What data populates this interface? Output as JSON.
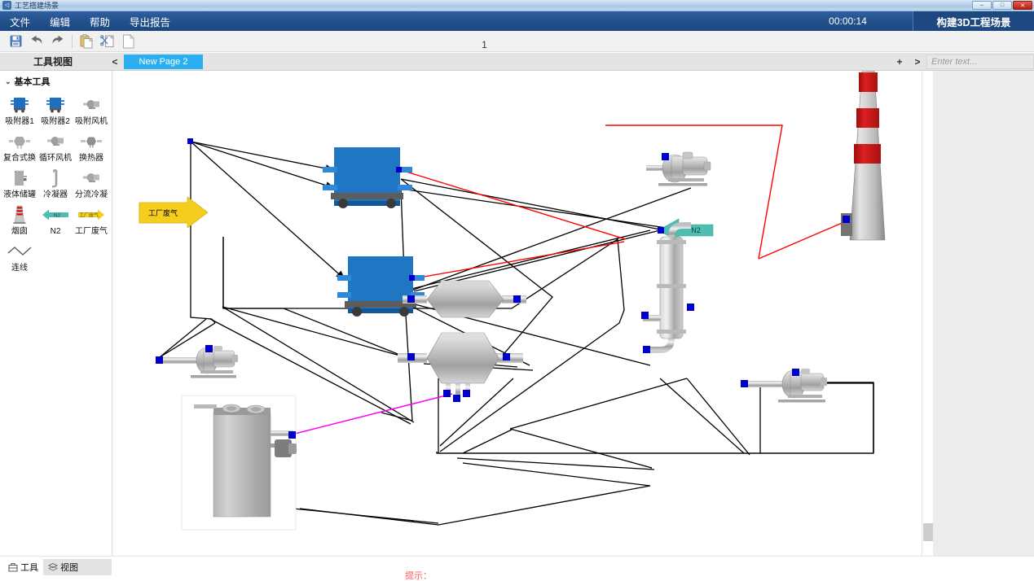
{
  "window": {
    "title": "工艺搭建场景",
    "app_icon": "app-icon",
    "controls": {
      "minimize": "–",
      "maximize": "□",
      "close": "✕"
    }
  },
  "menu": {
    "items": [
      {
        "label": "文件",
        "name": "menu-file"
      },
      {
        "label": "编辑",
        "name": "menu-edit"
      },
      {
        "label": "帮助",
        "name": "menu-help"
      },
      {
        "label": "导出报告",
        "name": "menu-export-report"
      }
    ],
    "timer": "00:00:14",
    "mode_button": "构建3D工程场景"
  },
  "toolbar": {
    "buttons": [
      {
        "name": "save-icon",
        "title": "保存"
      },
      {
        "name": "undo-icon",
        "title": "撤销"
      },
      {
        "name": "redo-icon",
        "title": "重做"
      },
      {
        "name": "paste-icon",
        "title": "粘贴"
      },
      {
        "name": "cut-icon",
        "title": "剪切"
      },
      {
        "name": "new-page-icon",
        "title": "新建"
      }
    ],
    "page_number": "1"
  },
  "tabstrip": {
    "tool_view_label": "工具视图",
    "collapse_arrow": "<",
    "page_tab": "New Page 2",
    "add_button": "+",
    "next_button": ">",
    "text_placeholder": "Enter text..."
  },
  "sidebar": {
    "group_title": "基本工具",
    "chevron": "⌄",
    "tools": [
      {
        "label": "吸附器1",
        "icon": "adsorber-1-icon",
        "name": "tool-adsorber-1"
      },
      {
        "label": "吸附器2",
        "icon": "adsorber-2-icon",
        "name": "tool-adsorber-2"
      },
      {
        "label": "吸附风机",
        "icon": "adsorption-fan-icon",
        "name": "tool-adsorption-fan"
      },
      {
        "label": "复合式换",
        "icon": "composite-exchanger-icon",
        "name": "tool-composite-exchanger"
      },
      {
        "label": "循环风机",
        "icon": "circulation-fan-icon",
        "name": "tool-circulation-fan"
      },
      {
        "label": "换热器",
        "icon": "heat-exchanger-icon",
        "name": "tool-heat-exchanger"
      },
      {
        "label": "液体储罐",
        "icon": "liquid-tank-icon",
        "name": "tool-liquid-tank"
      },
      {
        "label": "冷凝器",
        "icon": "condenser-icon",
        "name": "tool-condenser"
      },
      {
        "label": "分流冷凝",
        "icon": "split-condenser-icon",
        "name": "tool-split-condenser"
      },
      {
        "label": "烟囱",
        "icon": "chimney-icon",
        "name": "tool-chimney"
      },
      {
        "label": "N2",
        "icon": "n2-arrow-icon",
        "name": "tool-n2"
      },
      {
        "label": "工厂废气",
        "icon": "factory-exhaust-icon",
        "name": "tool-factory-exhaust"
      },
      {
        "label": "连线",
        "icon": "connector-line-icon",
        "name": "tool-connector"
      }
    ]
  },
  "canvas": {
    "labels": {
      "factory_exhaust": "工厂废气",
      "n2": "N2"
    },
    "colors": {
      "adsorber_blue": "#1f77c4",
      "exhaust_yellow": "#f5cd1e",
      "n2_teal": "#4fbdb0",
      "link_black": "#000000",
      "link_red": "#ff0000",
      "link_magenta": "#ff00ff",
      "port_blue": "#0000cc",
      "chimney_red": "#cc1111"
    }
  },
  "rightpanel": {
    "text": ""
  },
  "statusbar": {
    "tabs": [
      {
        "label": "工具",
        "icon": "tools-icon",
        "name": "status-tab-tools",
        "active": false
      },
      {
        "label": "视图",
        "icon": "layers-icon",
        "name": "status-tab-view",
        "active": true
      }
    ],
    "hint": "提示："
  }
}
